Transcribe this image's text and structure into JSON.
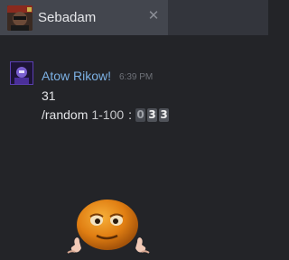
{
  "tab": {
    "title": "Sebadam",
    "close_glyph": "✕",
    "avatar_icon": "profile-avatar"
  },
  "message": {
    "author": "Atow Rikow!",
    "time": "6:39 PM",
    "line1": "31",
    "command": "/random",
    "range": "1-100",
    "colon": ":",
    "digits": [
      "0",
      "3",
      "3"
    ],
    "emoji_icon": "orange-smiley-emoji-with-hands"
  },
  "colors": {
    "background": "#232428",
    "tab_bar": "#33353c",
    "active_tab": "#43464e",
    "author": "#7cb1e4",
    "timestamp": "#6e7178",
    "text": "#e3e4e7"
  }
}
